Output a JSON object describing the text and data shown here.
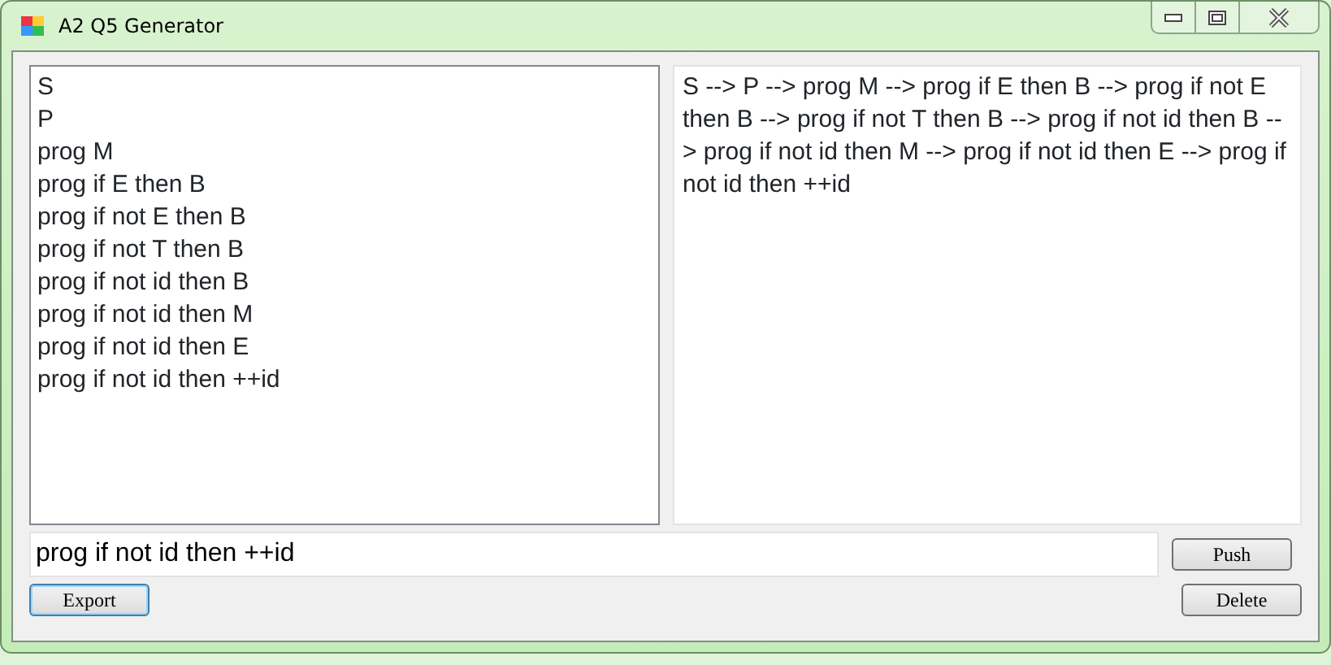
{
  "window": {
    "title": "A2 Q5 Generator"
  },
  "derivation_list": {
    "items": [
      "S",
      "P",
      "prog M",
      "prog if E then B",
      "prog if not E then B",
      "prog if not T then B",
      "prog if not id then B",
      "prog if not id then M",
      "prog if not id then E",
      "prog if not id then ++id"
    ]
  },
  "output_text": "S --> P --> prog M --> prog if E then B --> prog if not E then B --> prog if not T then B --> prog if not id then B --> prog if not id then M --> prog if not id then E --> prog if not id then ++id",
  "input": {
    "value": "prog if not id then ++id"
  },
  "buttons": [
    {
      "label": "Push",
      "focused": false
    },
    {
      "label": "Export",
      "focused": true
    },
    {
      "label": "Delete",
      "focused": false
    }
  ]
}
